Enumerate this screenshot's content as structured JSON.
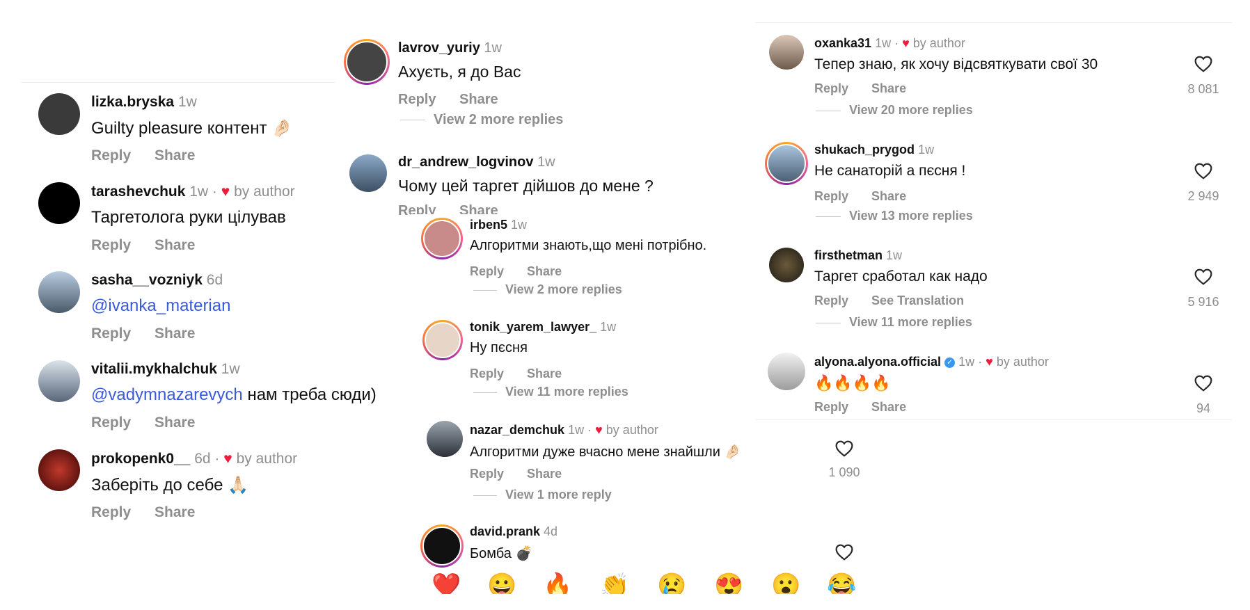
{
  "left_panel": [
    {
      "user": "lizka.bryska",
      "time": "1w",
      "text": "Guilty pleasure контент 🤌🏻",
      "reply": "Reply",
      "share": "Share",
      "avatar_color": "#3a3a3a"
    },
    {
      "user": "tarashevchuk",
      "time": "1w · ",
      "by_author": "by author",
      "text": "Таргетолога руки цілував",
      "reply": "Reply",
      "share": "Share",
      "avatar_color": "#000000"
    },
    {
      "user": "sasha__vozniyk",
      "time": "6d",
      "mention": "@ivanka_materian",
      "text": "",
      "reply": "Reply",
      "share": "Share",
      "avatar_color": "#6f8aa6"
    },
    {
      "user": "vitalii.mykhalchuk",
      "time": "1w",
      "mention": "@vadymnazarevych",
      "text": " нам треба сюди)",
      "reply": "Reply",
      "share": "Share",
      "avatar_color": "#8a9fb3"
    },
    {
      "user": "prokopenk0__",
      "time": "6d · ",
      "by_author": "by author",
      "text": "Заберіть до себе 🙏🏻",
      "reply": "Reply",
      "share": "Share",
      "avatar_color": "#7a1414"
    }
  ],
  "middle_top": [
    {
      "user": "lavrov_yuriy",
      "time": "1w",
      "text": "Ахуєть, я до Вас",
      "reply": "Reply",
      "share": "Share",
      "more": "View 2 more replies"
    },
    {
      "user": "dr_andrew_logvinov",
      "time": "1w",
      "text": "Чому цей таргет дійшов до мене ?",
      "reply": "Reply",
      "share": "Share"
    }
  ],
  "middle_bottom": [
    {
      "user": "irben5",
      "time": "1w",
      "text": "Алгоритми знають,що мені потрібно.",
      "reply": "Reply",
      "share": "Share",
      "more": "View 2 more replies"
    },
    {
      "user": "tonik_yarem_lawyer_",
      "time": "1w",
      "text": "Ну пєсня",
      "reply": "Reply",
      "share": "Share",
      "more": "View 11 more replies"
    },
    {
      "user": "nazar_demchuk",
      "time": "1w · ",
      "by_author": "by author",
      "text": "Алгоритми дуже вчасно мене знайшли 🤌🏻",
      "reply": "Reply",
      "share": "Share",
      "more": "View 1 more reply",
      "likes": "1 090"
    },
    {
      "user": "david.prank",
      "time": "4d",
      "text": "Бомба 💣",
      "likes": ""
    }
  ],
  "emoji_bar": [
    "❤️",
    "😀",
    "🔥",
    "👏",
    "😢",
    "😍",
    "😮",
    "😂"
  ],
  "right_panel": [
    {
      "user": "oxanka31",
      "time": "1w · ",
      "by_author": "by author",
      "text": "Тепер знаю, як хочу відсвяткувати свої 30",
      "reply": "Reply",
      "share": "Share",
      "more": "View 20 more replies",
      "likes": "8 081"
    },
    {
      "user": "shukach_prygod",
      "time": "1w",
      "text": "Не санаторій а пєсня !",
      "reply": "Reply",
      "share": "Share",
      "more": "View 13 more replies",
      "likes": "2 949"
    },
    {
      "user": "firsthetman",
      "time": "1w",
      "text": "Таргет сработал как надо",
      "reply": "Reply",
      "share": "See Translation",
      "more": "View 11 more replies",
      "likes": "5 916"
    },
    {
      "user": "alyona.alyona.official",
      "time": "1w · ",
      "by_author": "by author",
      "text": "🔥🔥🔥🔥",
      "reply": "Reply",
      "share": "Share",
      "likes": "94"
    }
  ],
  "colors": {
    "heart": "#ed1c3a",
    "mention": "#3a5bd9",
    "muted": "#8e8e8e",
    "verified": "#3897f0"
  }
}
